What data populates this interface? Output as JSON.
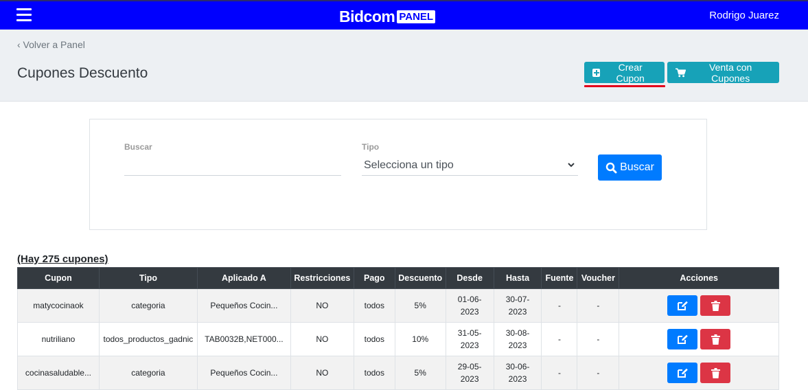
{
  "navbar": {
    "brand": "Bidcom",
    "brand_badge": "PANEL",
    "user": "Rodrigo Juarez"
  },
  "header": {
    "back_link": "‹ Volver a Panel",
    "title": "Cupones Descuento",
    "crear_label": "Crear Cupon",
    "venta_label": "Venta con Cupones"
  },
  "search": {
    "buscar_label": "Buscar",
    "buscar_value": "",
    "tipo_label": "Tipo",
    "tipo_selected": "Selecciona un tipo",
    "button_label": "Buscar"
  },
  "count_text": "(Hay 275 cupones)",
  "table": {
    "headers": [
      "Cupon",
      "Tipo",
      "Aplicado A",
      "Restricciones",
      "Pago",
      "Descuento",
      "Desde",
      "Hasta",
      "Fuente",
      "Voucher",
      "Acciones"
    ],
    "rows": [
      {
        "cupon": "matycocinaok",
        "tipo": "categoria",
        "aplicado": "Pequeños Cocin...",
        "restricciones": "NO",
        "pago": "todos",
        "descuento": "5%",
        "desde_1": "01-06-",
        "desde_2": "2023",
        "hasta_1": "30-07-",
        "hasta_2": "2023",
        "fuente": "-",
        "voucher": "-"
      },
      {
        "cupon": "nutriliano",
        "tipo": "todos_productos_gadnic",
        "aplicado": "TAB0032B,NET000...",
        "restricciones": "NO",
        "pago": "todos",
        "descuento": "10%",
        "desde_1": "31-05-",
        "desde_2": "2023",
        "hasta_1": "30-08-",
        "hasta_2": "2023",
        "fuente": "-",
        "voucher": "-"
      },
      {
        "cupon": "cocinasaludable...",
        "tipo": "categoria",
        "aplicado": "Pequeños Cocin...",
        "restricciones": "NO",
        "pago": "todos",
        "descuento": "5%",
        "desde_1": "29-05-",
        "desde_2": "2023",
        "hasta_1": "30-06-",
        "hasta_2": "2023",
        "fuente": "-",
        "voucher": "-"
      }
    ]
  },
  "colors": {
    "navbar": "#0000fe",
    "teal": "#17a2b8",
    "primary": "#007bff",
    "danger": "#dc3545",
    "table_header": "#343a40"
  }
}
